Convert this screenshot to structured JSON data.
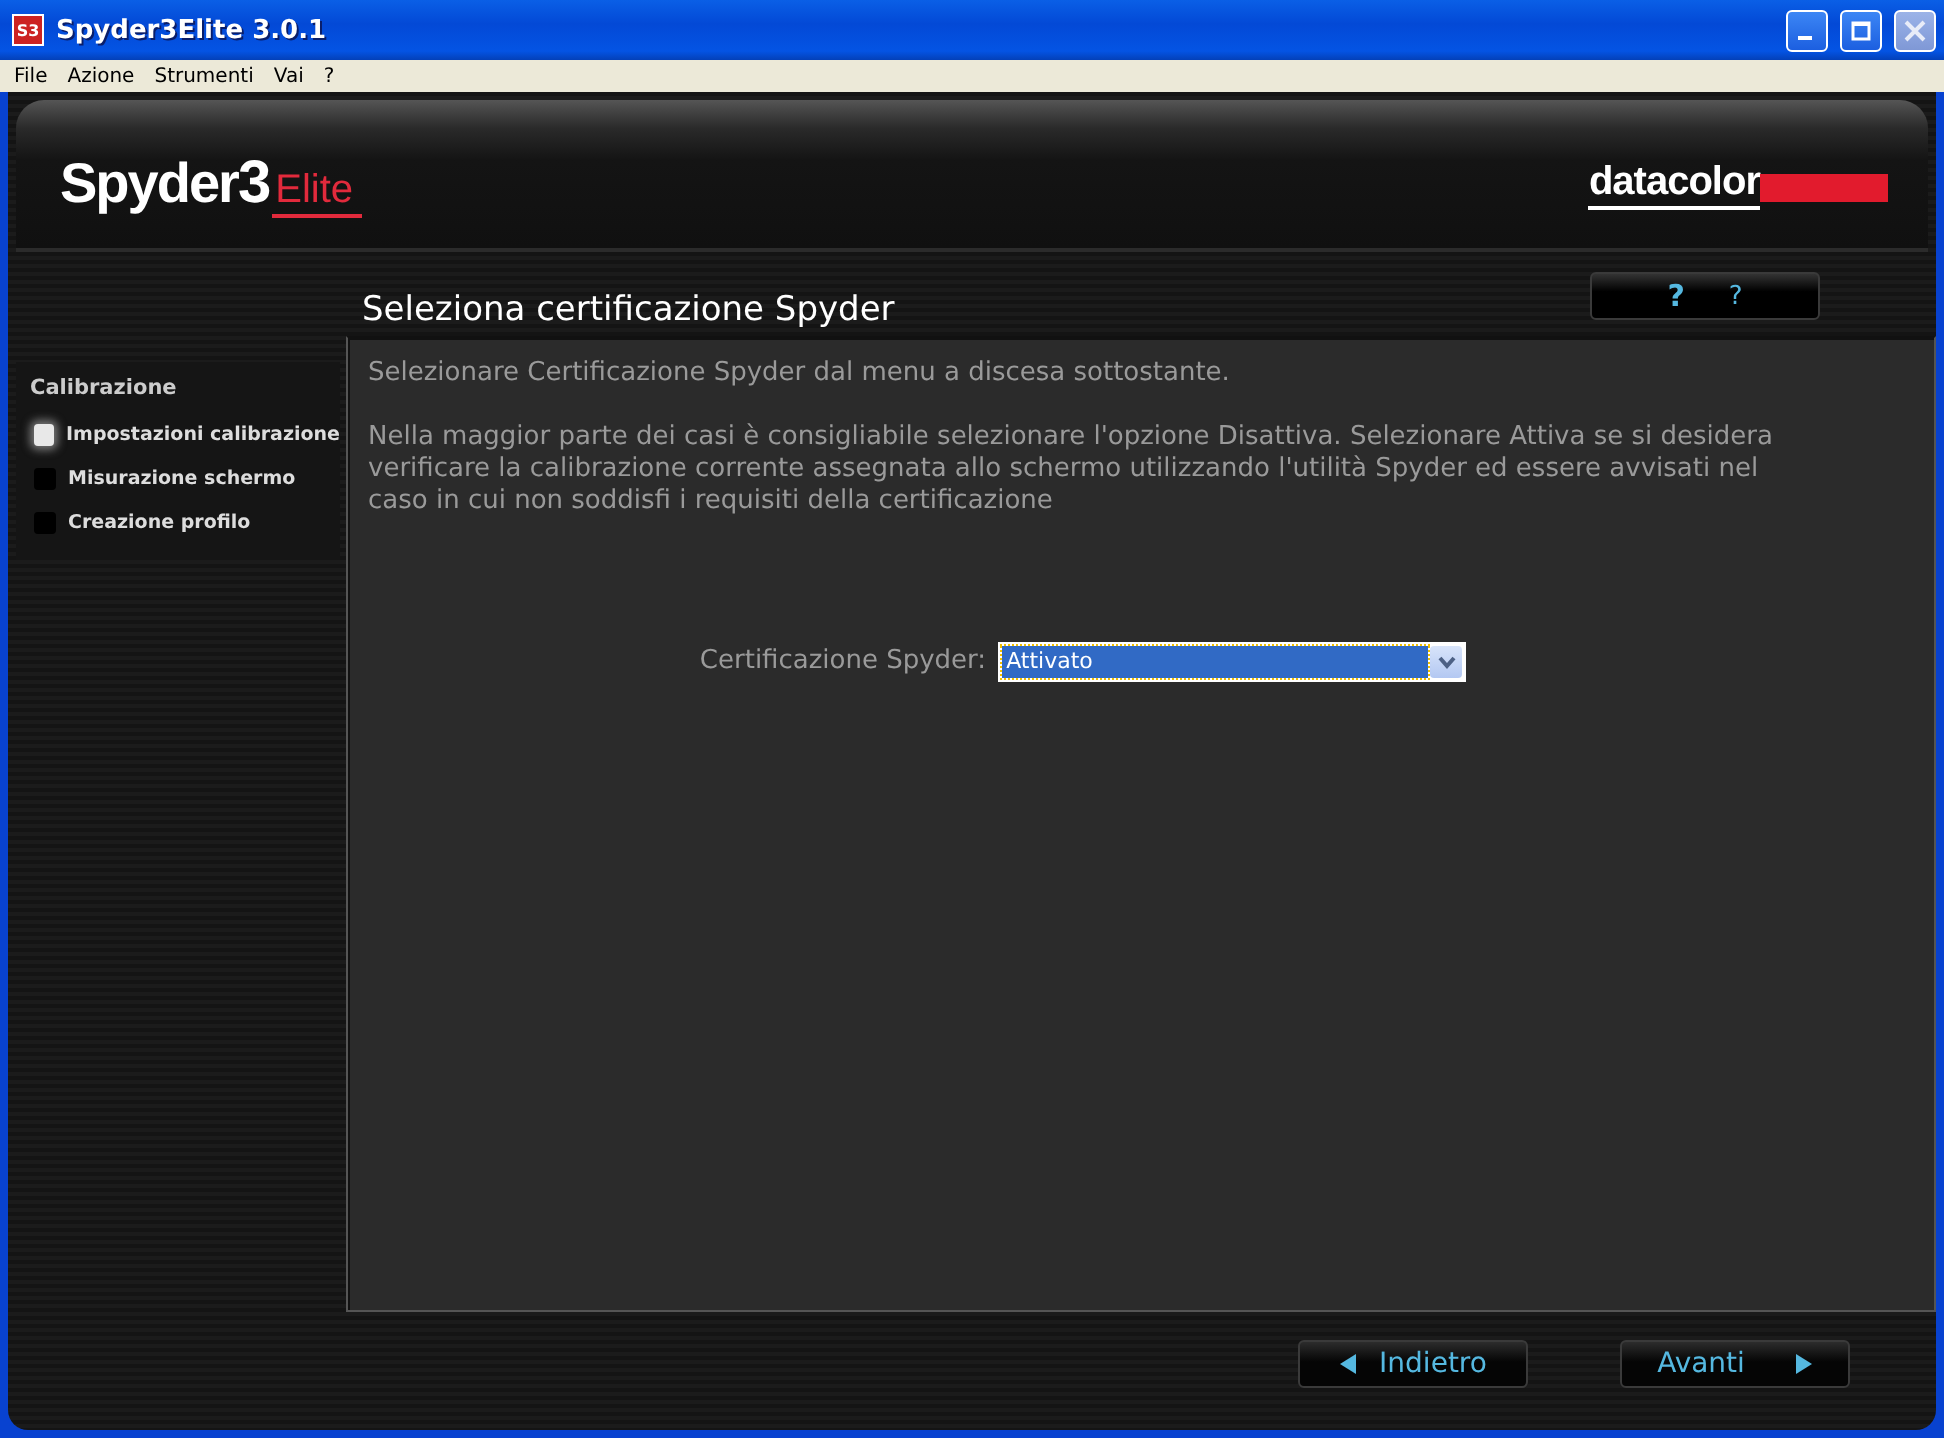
{
  "window": {
    "title": "Spyder3Elite 3.0.1",
    "app_icon": "S3"
  },
  "menu": [
    "File",
    "Azione",
    "Strumenti",
    "Vai",
    "?"
  ],
  "header": {
    "logo": {
      "name": "Spyder",
      "number": "3",
      "edition": "Elite"
    },
    "brand": "datacolor"
  },
  "sidebar": {
    "section": "Calibrazione",
    "items": [
      {
        "label": "Impostazioni calibrazione",
        "selected": true
      },
      {
        "label": "Misurazione schermo",
        "selected": false
      },
      {
        "label": "Creazione profilo",
        "selected": false
      }
    ]
  },
  "page": {
    "title": "Seleziona certificazione Spyder",
    "help": {
      "icon": "?",
      "label": "?"
    },
    "paragraphs": [
      "Selezionare Certificazione Spyder dal menu a discesa sottostante.",
      "Nella maggior parte dei casi è consigliabile selezionare l'opzione Disattiva. Selezionare Attiva se si desidera verificare la calibrazione corrente assegnata allo schermo utilizzando l'utilità Spyder ed essere avvisati nel caso in cui non soddisfi i requisiti della certificazione"
    ],
    "field": {
      "label": "Certificazione Spyder:",
      "value": "Attivato"
    }
  },
  "buttons": [
    {
      "label": "Indietro",
      "kind": "back"
    },
    {
      "label": "Avanti",
      "kind": "next"
    }
  ]
}
